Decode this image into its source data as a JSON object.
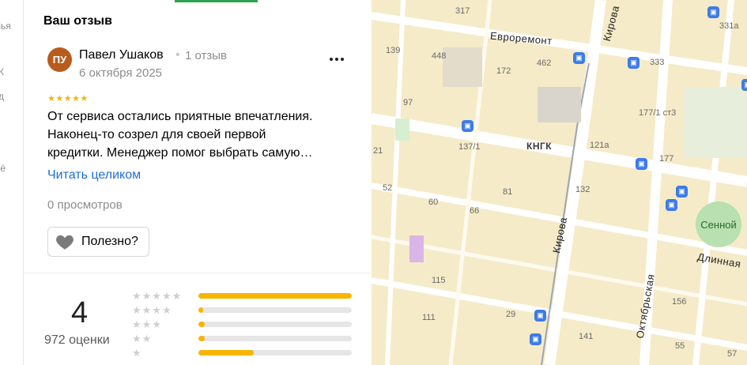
{
  "rail": {
    "items": [
      "лья",
      "К",
      "д",
      "ьё"
    ]
  },
  "review": {
    "section_title": "Ваш отзыв",
    "avatar_initials": "ПУ",
    "author": "Павел Ушаков",
    "author_reviews": "1 отзыв",
    "date": "6 октября 2025",
    "stars": "★★★★★",
    "text_lines": [
      "От сервиса остались приятные впечатления.",
      "Наконец-то созрел для своей первой",
      "кредитки. Менеджер помог выбрать самую…"
    ],
    "read_more": "Читать целиком",
    "views": "0 просмотров",
    "useful_label": "Полезно?"
  },
  "rating": {
    "value": "4",
    "count": "972 оценки",
    "distribution": [
      {
        "stars": "★★★★★",
        "fraction": 1.0
      },
      {
        "stars": "★★★★",
        "fraction": 0.03
      },
      {
        "stars": "★★★",
        "fraction": 0.04
      },
      {
        "stars": "★★",
        "fraction": 0.04
      },
      {
        "stars": "★",
        "fraction": 0.36
      }
    ]
  },
  "map": {
    "house_numbers": [
      "317",
      "331a",
      "139",
      "448",
      "462",
      "333",
      "172",
      "97",
      "177/1 ст3",
      "137/1",
      "121а",
      "177",
      "21",
      "52",
      "60",
      "81",
      "132",
      "66",
      "115",
      "111",
      "29",
      "156",
      "141",
      "55",
      "57"
    ],
    "streets": [
      "Евроремонт",
      "Кирова",
      "Кирова",
      "Октябрьская",
      "Длинная"
    ],
    "landmark": "КНГК",
    "park": "Сенной",
    "colors": {
      "map_bg": "#f5ebc8",
      "road": "#ffffff",
      "bus_stop": "#3e7be8",
      "rating_star": "#f7b500",
      "link": "#1e6ed6"
    }
  }
}
